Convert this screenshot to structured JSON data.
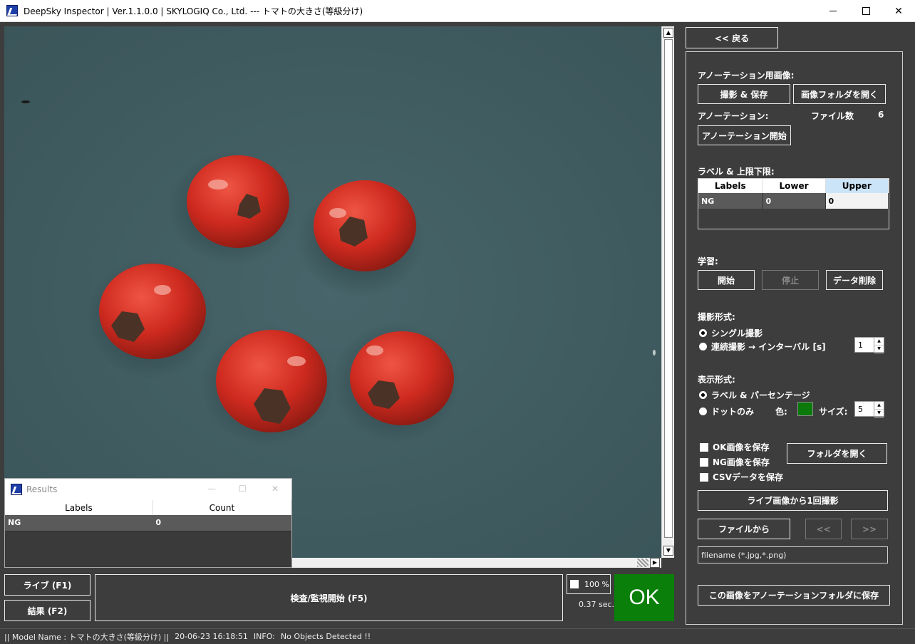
{
  "window": {
    "title": "DeepSky Inspector | Ver.1.1.0.0 | SKYLOGIQ Co., Ltd. --- トマトの大きさ(等級分け)"
  },
  "results_window": {
    "title": "Results",
    "columns": [
      "Labels",
      "Count"
    ],
    "rows": [
      {
        "label": "NG",
        "count": "0"
      }
    ]
  },
  "bottom": {
    "live_button": "ライブ (F1)",
    "results_button": "結果 (F2)",
    "inspect_button": "検査/監視開始 (F5)",
    "zoom_label": "100 %",
    "elapsed": "0.37 sec.",
    "verdict": "OK",
    "verdict_color": "#0a7f0a"
  },
  "status": {
    "model": "|| Model Name : トマトの大きさ(等級分け) ||",
    "timestamp": "20-06-23 16:18:51",
    "info_label": "INFO:",
    "info": "No Objects Detected !!"
  },
  "panel": {
    "back_button": "<< 戻る",
    "annotation_image_label": "アノーテーション用画像:",
    "capture_save_button": "撮影 & 保存",
    "open_image_folder_button": "画像フォルダを開く",
    "annotation_label": "アノーテーション:",
    "file_count_label": "ファイル数",
    "file_count": "6",
    "annotation_start_button": "アノーテーション開始",
    "limits_label": "ラベル & 上限下限:",
    "limits_table": {
      "columns": [
        "Labels",
        "Lower",
        "Upper"
      ],
      "rows": [
        {
          "label": "NG",
          "lower": "0",
          "upper": "0"
        }
      ]
    },
    "learning_label": "学習:",
    "learn_start_button": "開始",
    "learn_stop_button": "停止",
    "data_delete_button": "データ削除",
    "capture_mode_label": "撮影形式:",
    "capture_single": "シングル撮影",
    "capture_continuous": "連続撮影 → インターバル [s]",
    "interval_value": "1",
    "display_mode_label": "表示形式:",
    "display_label_pct": "ラベル & パーセンテージ",
    "display_dots": "ドットのみ",
    "color_label": "色:",
    "dot_color": "#0b7a0b",
    "size_label": "サイズ:",
    "size_value": "5",
    "save_ok": "OK画像を保存",
    "save_ng": "NG画像を保存",
    "save_csv": "CSVデータを保存",
    "open_folder_button": "フォルダを開く",
    "capture_once_button": "ライブ画像から1回撮影",
    "from_file_button": "ファイルから",
    "prev_button": "<<",
    "next_button": ">>",
    "filename_placeholder": "filename (*.jpg,*.png)",
    "save_to_annotation_button": "この画像をアノーテーションフォルダに保存"
  }
}
